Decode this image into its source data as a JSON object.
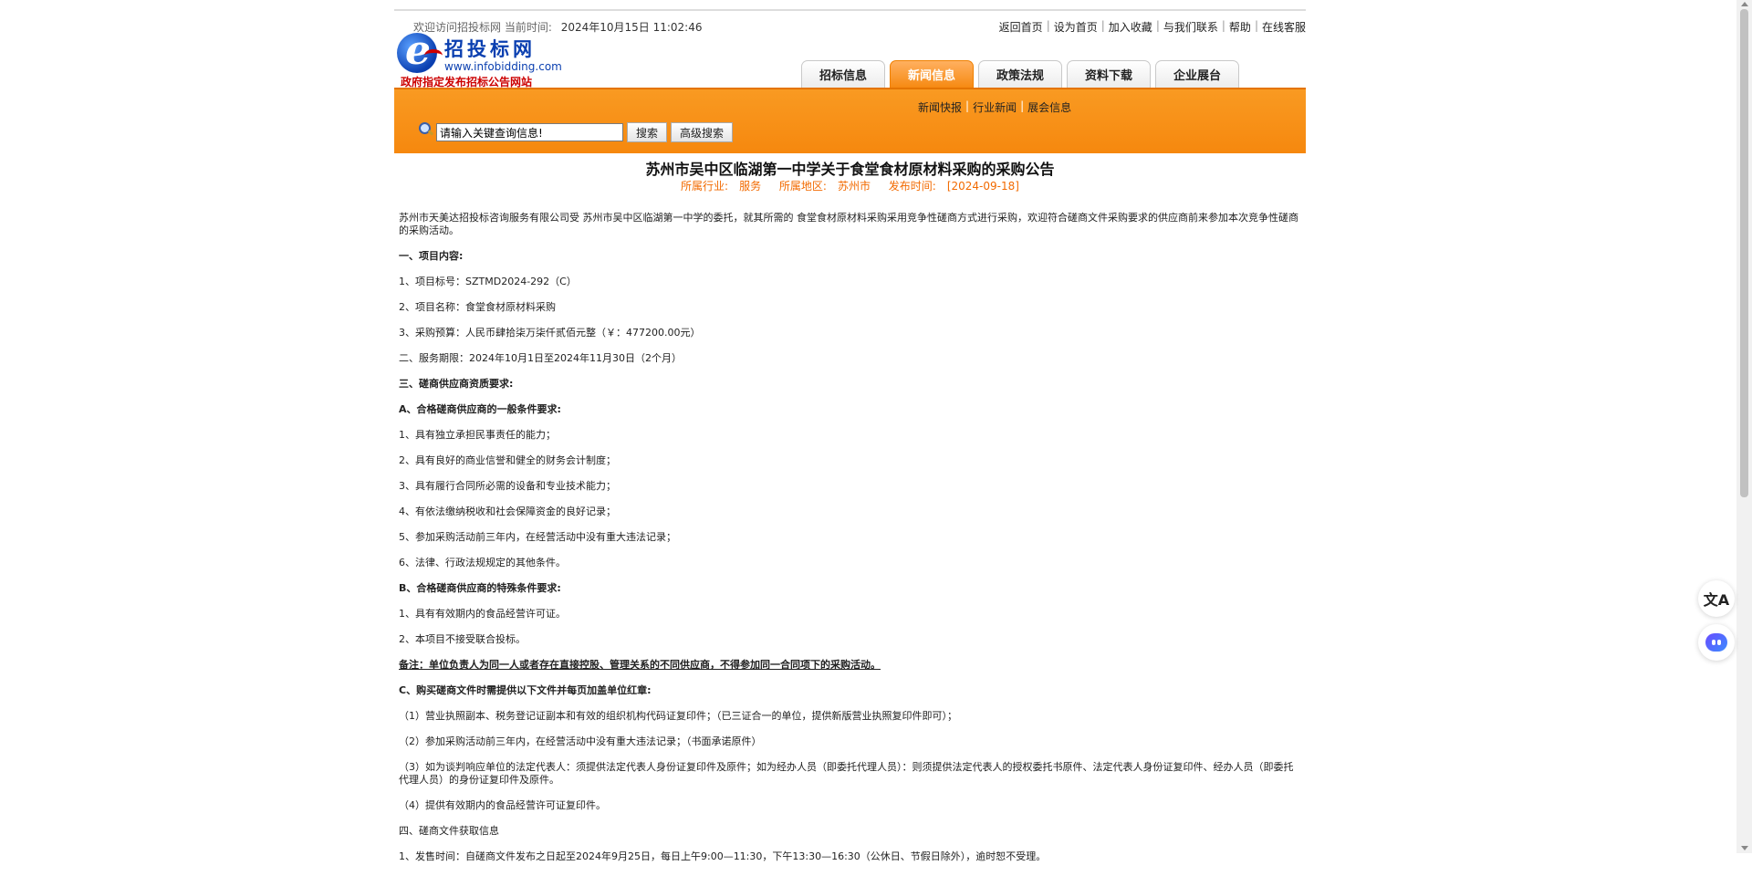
{
  "header": {
    "welcome": "欢迎访问招投标网 当前时间:",
    "datetime": "2024年10月15日 11:02:46",
    "links": [
      "返回首页",
      "设为首页",
      "加入收藏",
      "与我们联系",
      "帮助",
      "在线客服"
    ]
  },
  "logo": {
    "name": "招投标网",
    "url": "www.infobidding.com",
    "slogan": "政府指定发布招标公告网站"
  },
  "tabs": [
    {
      "label": "招标信息",
      "active": false
    },
    {
      "label": "新闻信息",
      "active": true
    },
    {
      "label": "政策法规",
      "active": false
    },
    {
      "label": "资料下载",
      "active": false
    },
    {
      "label": "企业展台",
      "active": false
    }
  ],
  "subnav": [
    "新闻快报",
    "行业新闻",
    "展会信息"
  ],
  "search": {
    "placeholder": "请输入关键查询信息!",
    "search_button": "搜索",
    "advanced_button": "高级搜索"
  },
  "article": {
    "title": "苏州市吴中区临湖第一中学关于食堂食材原材料采购的采购公告",
    "industry": "所属行业:　服务",
    "region": "所属地区:　苏州市",
    "published": "发布时间:　[2024-09-18]",
    "paragraphs": [
      {
        "text": "苏州市天美达招投标咨询服务有限公司受 苏州市吴中区临湖第一中学的委托，就其所需的 食堂食材原材料采购采用竞争性磋商方式进行采购，欢迎符合磋商文件采购要求的供应商前来参加本次竞争性磋商的采购活动。",
        "style": ""
      },
      {
        "text": "一、项目内容:",
        "style": "b"
      },
      {
        "text": "1、项目标号：SZTMD2024-292（C）",
        "style": ""
      },
      {
        "text": "2、项目名称：食堂食材原材料采购",
        "style": ""
      },
      {
        "text": "3、采购预算：人民币肆拾柒万柒仟贰佰元整（￥：477200.00元）",
        "style": ""
      },
      {
        "text": "二、服务期限：2024年10月1日至2024年11月30日（2个月）",
        "style": ""
      },
      {
        "text": "三、磋商供应商资质要求:",
        "style": "b"
      },
      {
        "text": "A、合格磋商供应商的一般条件要求:",
        "style": "b"
      },
      {
        "text": "1、具有独立承担民事责任的能力；",
        "style": ""
      },
      {
        "text": "2、具有良好的商业信誉和健全的财务会计制度；",
        "style": ""
      },
      {
        "text": "3、具有履行合同所必需的设备和专业技术能力；",
        "style": ""
      },
      {
        "text": "4、有依法缴纳税收和社会保障资金的良好记录；",
        "style": ""
      },
      {
        "text": "5、参加采购活动前三年内，在经营活动中没有重大违法记录；",
        "style": ""
      },
      {
        "text": "6、法律、行政法规规定的其他条件。",
        "style": ""
      },
      {
        "text": "B、合格磋商供应商的特殊条件要求:",
        "style": "b"
      },
      {
        "text": "1、具有有效期内的食品经营许可证。",
        "style": ""
      },
      {
        "text": "2、本项目不接受联合投标。",
        "style": ""
      },
      {
        "text": "备注：单位负责人为同一人或者存在直接控股、管理关系的不同供应商，不得参加同一合同项下的采购活动。",
        "style": "u"
      },
      {
        "text": "C、购买磋商文件时需提供以下文件并每页加盖单位红章:",
        "style": "b"
      },
      {
        "text": "（1）营业执照副本、税务登记证副本和有效的组织机构代码证复印件；（已三证合一的单位，提供新版营业执照复印件即可）；",
        "style": ""
      },
      {
        "text": "（2）参加采购活动前三年内，在经营活动中没有重大违法记录；（书面承诺原件）",
        "style": ""
      },
      {
        "text": "（3）如为谈判响应单位的法定代表人：须提供法定代表人身份证复印件及原件；如为经办人员（即委托代理人员）：则须提供法定代表人的授权委托书原件、法定代表人身份证复印件、经办人员（即委托代理人员）的身份证复印件及原件。",
        "style": ""
      },
      {
        "text": "（4）提供有效期内的食品经营许可证复印件。",
        "style": ""
      },
      {
        "text": "四、磋商文件获取信息",
        "style": ""
      },
      {
        "text": "1、发售时间：自磋商文件发布之日起至2024年9月25日，每日上午9:00—11:30，下午13:30—16:30（公休日、节假日除外），逾时恕不受理。",
        "style": ""
      }
    ]
  },
  "floating": {
    "translate_icon": "translate-icon",
    "ai_icon": "ai-assistant-icon"
  },
  "colors": {
    "orange": "#f68a12",
    "meta": "#f26a00",
    "logo_blue": "#0a3fb0",
    "logo_red": "#cc0000"
  }
}
